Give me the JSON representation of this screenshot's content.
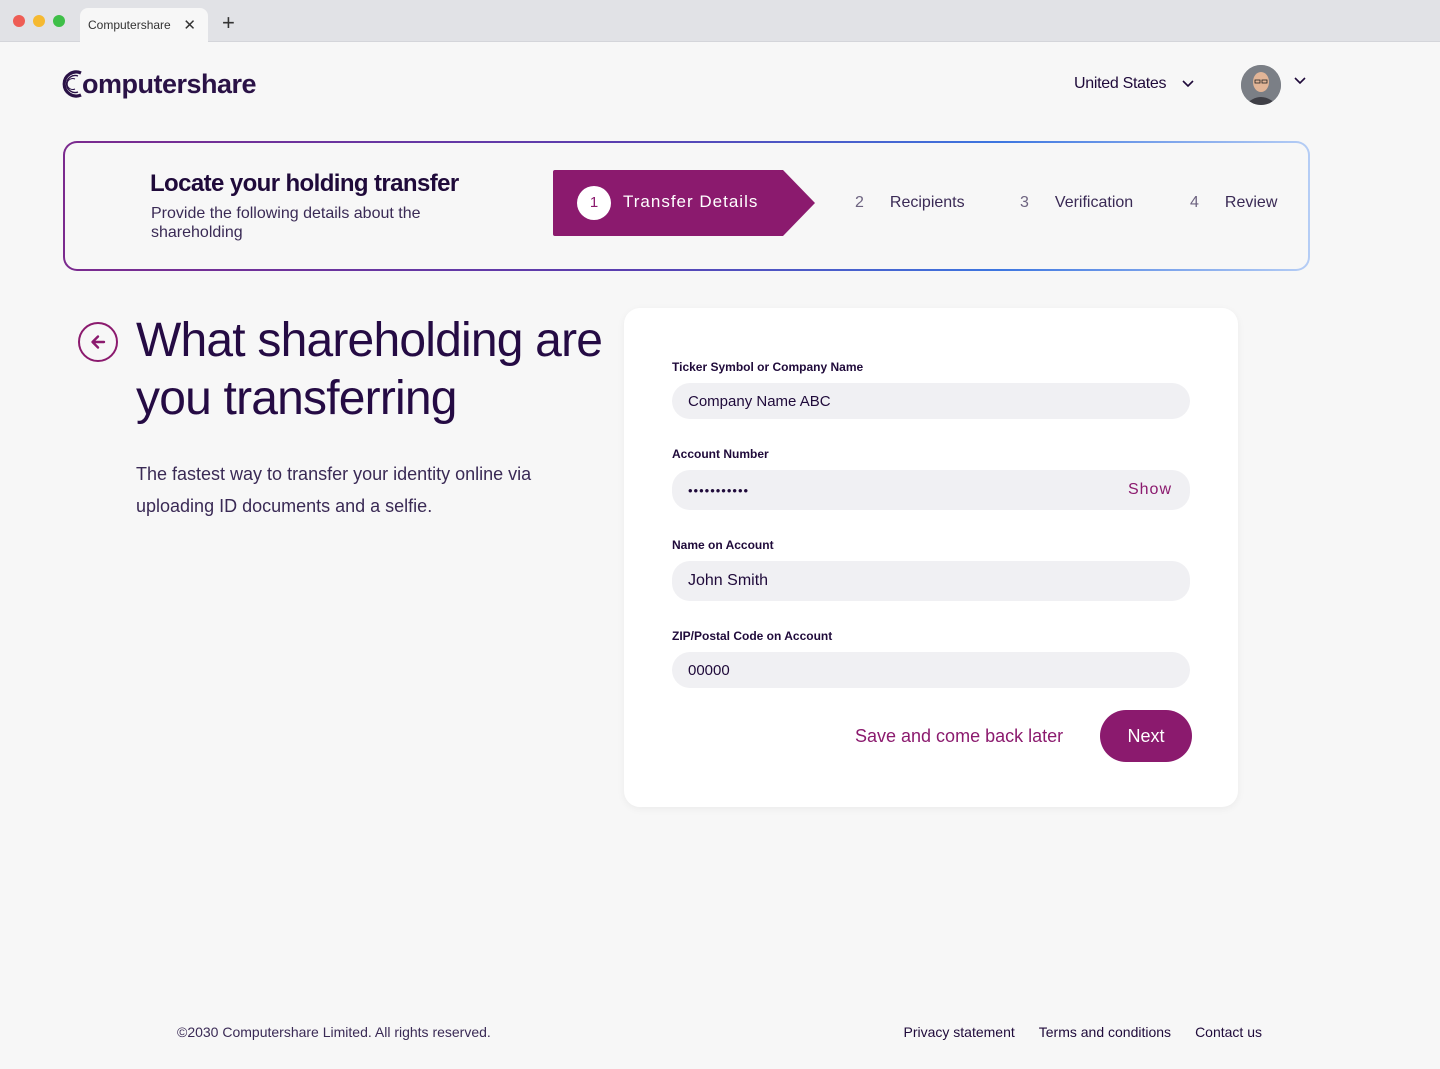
{
  "browser": {
    "tab_title": "Computershare",
    "tab_close_icon": "close-icon",
    "new_tab_icon": "plus-icon"
  },
  "header": {
    "logo_text": "omputershare",
    "country": "United States",
    "country_icon": "chevron-down-icon",
    "avatar_icon": "user-avatar",
    "avatar_caret_icon": "chevron-down-icon"
  },
  "progress": {
    "title": "Locate your holding transfer",
    "subtitle": "Provide the following details about the shareholding",
    "steps": [
      {
        "number": "1",
        "label": "Transfer Details",
        "active": true
      },
      {
        "number": "2",
        "label": "Recipients",
        "active": false
      },
      {
        "number": "3",
        "label": "Verification",
        "active": false
      },
      {
        "number": "4",
        "label": "Review",
        "active": false
      }
    ]
  },
  "intro": {
    "back_icon": "arrow-left-icon",
    "headline": "What shareholding are you transferring",
    "lead": "The fastest way to transfer your identity online via uploading ID documents and a selfie."
  },
  "form": {
    "ticker_label": "Ticker Symbol or Company Name",
    "ticker_value": "Company Name ABC",
    "account_label": "Account Number",
    "account_value": "•••••••••••",
    "account_show": "Show",
    "name_label": "Name on Account",
    "name_value": "John Smith",
    "zip_label": "ZIP/Postal Code on Account",
    "zip_value": "00000",
    "save_label": "Save and come back later",
    "next_label": "Next"
  },
  "footer": {
    "copyright": "©2030 Computershare Limited. All rights reserved.",
    "links": [
      "Privacy statement",
      "Terms and conditions",
      "Contact us"
    ]
  },
  "colors": {
    "brand": "#8b1a6e",
    "heading": "#250b44",
    "input_bg": "#f0f0f3",
    "page_bg": "#f7f7f7"
  }
}
